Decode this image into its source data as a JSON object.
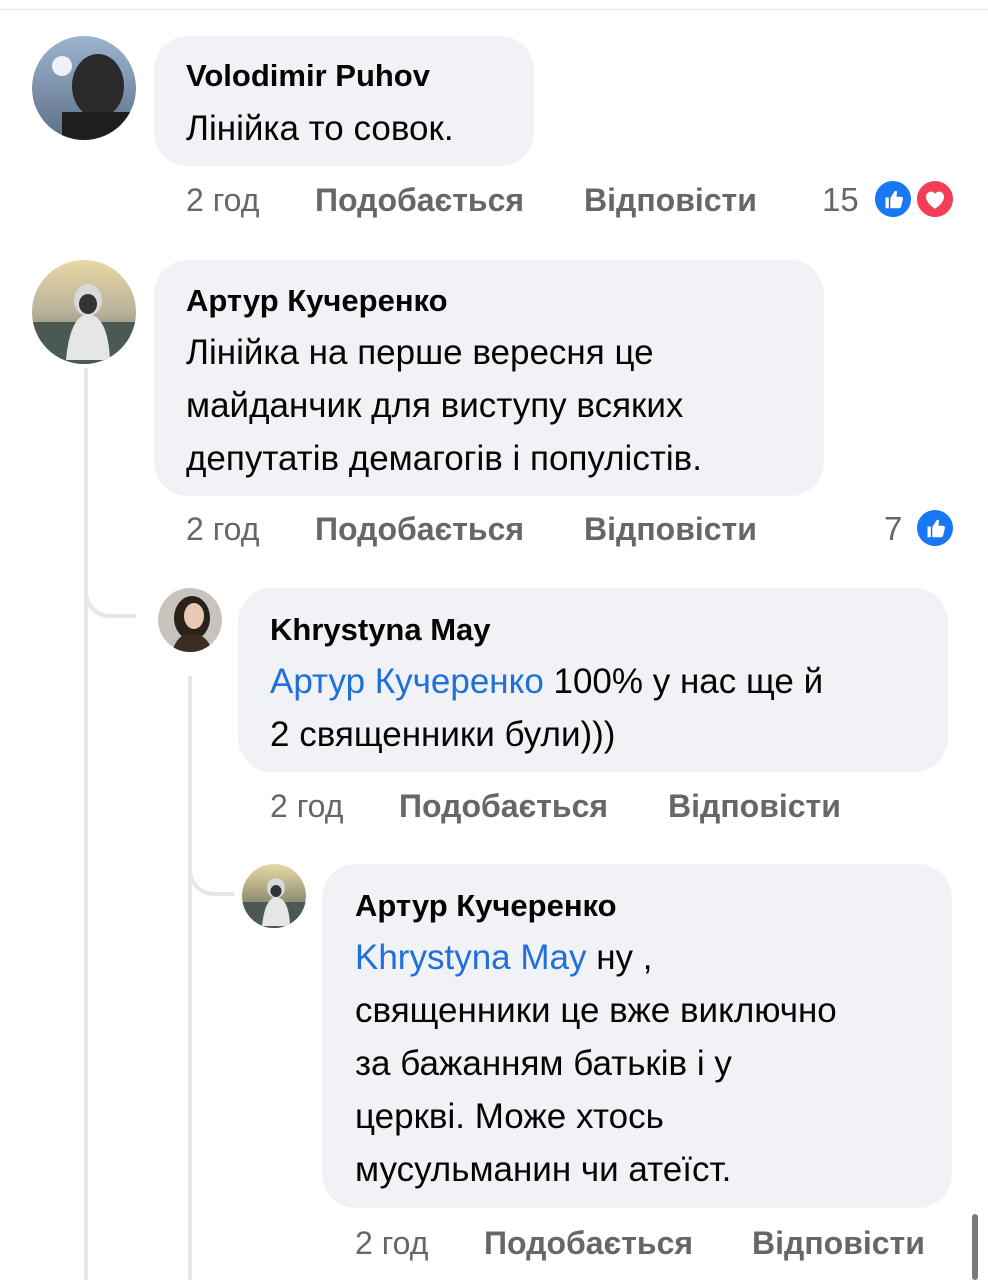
{
  "comments": [
    {
      "author": "Volodimir  Puhov",
      "text_lines": [
        "Лінійка то совок."
      ],
      "time": "2 год",
      "like_label": "Подобається",
      "reply_label": "Відповісти",
      "reaction_count": "15",
      "reactions": [
        "like-icon",
        "love-icon"
      ]
    },
    {
      "author": "Артур Кучеренко",
      "text_lines": [
        "Лінійка на перше вересня це",
        "майданчик для виступу всяких",
        "депутатів демагогів і популістів."
      ],
      "time": "2 год",
      "like_label": "Подобається",
      "reply_label": "Відповісти",
      "reaction_count": "7",
      "reactions": [
        "like-icon"
      ]
    },
    {
      "author": "Khrystyna May",
      "mention": "Артур Кучеренко",
      "text_rest_line1": " 100% у нас ще й",
      "text_line2": "2 священники були)))",
      "time": "2 год",
      "like_label": "Подобається",
      "reply_label": "Відповісти"
    },
    {
      "author": "Артур Кучеренко",
      "mention": "Khrystyna May",
      "text_rest_line1": " ну ,",
      "text_lines": [
        "священники це вже виключно",
        "за бажанням батьків і у",
        "церкві. Може хтось",
        "мусульманин чи атеїст."
      ],
      "time": "2 год",
      "like_label": "Подобається",
      "reply_label": "Відповісти"
    }
  ],
  "colors": {
    "bubble": "#f0f2f5",
    "text": "#050505",
    "meta": "#65676b",
    "mention": "#216fdb",
    "like": "#1877f2",
    "love": "#f33e58",
    "thread_line": "#e4e6eb"
  }
}
